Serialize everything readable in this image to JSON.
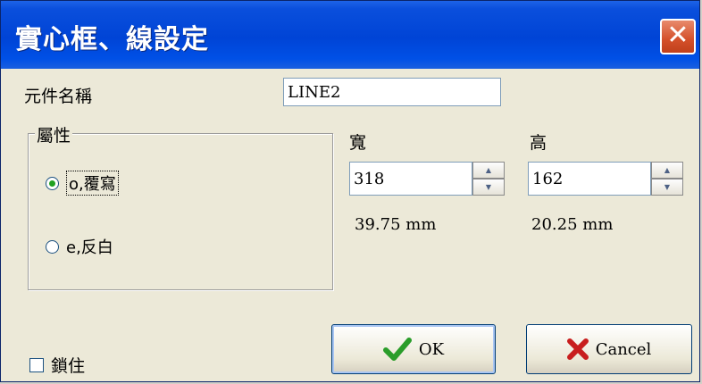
{
  "window": {
    "title": "實心框、線設定",
    "close_glyph": "✕"
  },
  "element_name": {
    "label": "元件名稱",
    "value": "LINE2"
  },
  "attribute_group": {
    "legend": "屬性",
    "options": [
      {
        "label": "o,覆寫",
        "checked": true
      },
      {
        "label": "e,反白",
        "checked": false
      }
    ]
  },
  "width": {
    "label": "寬",
    "value": "318",
    "mm": "39.75 mm"
  },
  "height": {
    "label": "高",
    "value": "162",
    "mm": "20.25 mm"
  },
  "lock": {
    "label": "鎖住",
    "checked": false
  },
  "buttons": {
    "ok": "OK",
    "cancel": "Cancel"
  },
  "icons": {
    "spin_up": "▲",
    "spin_down": "▼",
    "ok_icon": "checkmark-icon",
    "cancel_icon": "x-mark-icon"
  },
  "colors": {
    "titlebar": "#0044d6",
    "ok_check": "#2a9d2a",
    "cancel_x": "#c81e1e"
  }
}
